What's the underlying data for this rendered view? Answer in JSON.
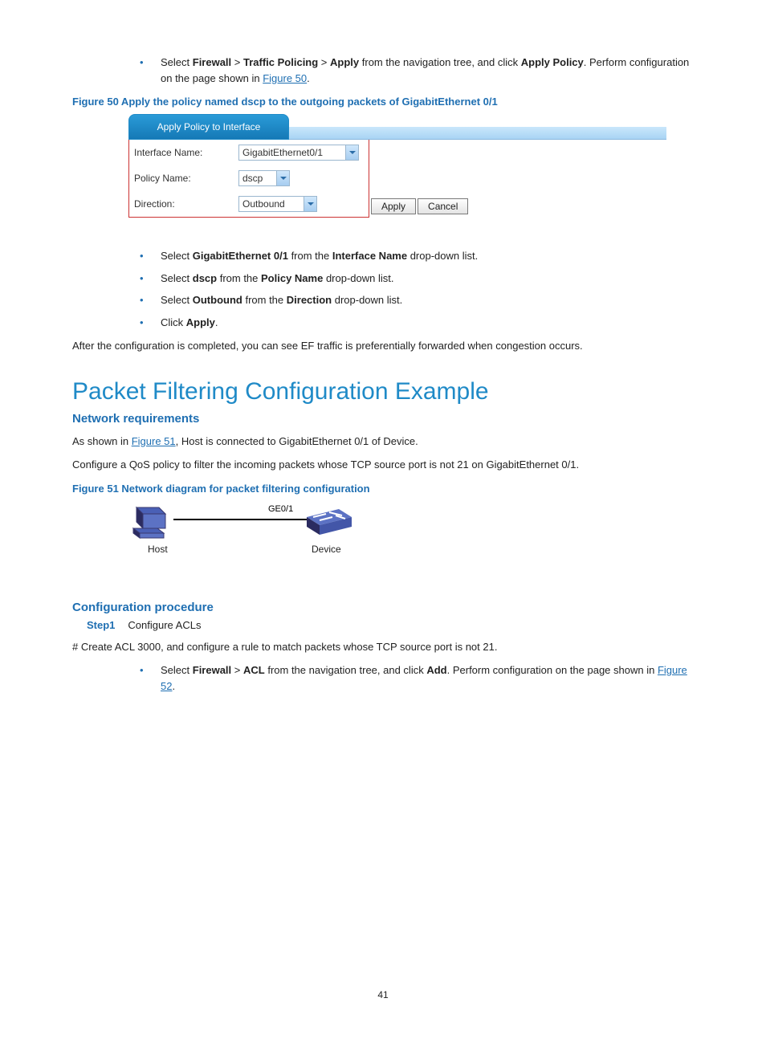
{
  "intro_bullet": {
    "pre1": "Select ",
    "b1": "Firewall",
    "gt1": " > ",
    "b2": "Traffic Policing",
    "gt2": " > ",
    "b3": "Apply",
    "mid": " from the navigation tree, and click ",
    "b4": "Apply Policy",
    "post": ". Perform configuration on the page shown in ",
    "link": "Figure 50",
    "end": "."
  },
  "fig50": {
    "caption_pre": "Figure 50 Apply the policy named ",
    "caption_bold": "dscp",
    "caption_post": " to the outgoing packets of GigabitEthernet 0/1",
    "tab": "Apply Policy to Interface",
    "rows": {
      "r1_label": "Interface Name:",
      "r1_value": "GigabitEthernet0/1",
      "r2_label": "Policy Name:",
      "r2_value": "dscp",
      "r3_label": "Direction:",
      "r3_value": "Outbound"
    },
    "apply": "Apply",
    "cancel": "Cancel"
  },
  "sub_bullets": {
    "l1a": "Select ",
    "l1b": "GigabitEthernet 0/1",
    "l1c": " from the ",
    "l1d": "Interface Name",
    "l1e": " drop-down list.",
    "l2a": "Select ",
    "l2b": "dscp",
    "l2c": " from the ",
    "l2d": "Policy Name",
    "l2e": " drop-down list.",
    "l3a": "Select ",
    "l3b": "Outbound",
    "l3c": " from the ",
    "l3d": "Direction",
    "l3e": " drop-down list.",
    "l4a": "Click ",
    "l4b": "Apply",
    "l4c": "."
  },
  "after_para": "After the configuration is completed, you can see EF traffic is preferentially forwarded when congestion occurs.",
  "h1": "Packet Filtering Configuration Example",
  "h2a": "Network requirements",
  "net_p1a": "As shown in ",
  "net_p1_link": "Figure 51",
  "net_p1b": ", Host is connected to GigabitEthernet 0/1 of Device.",
  "net_p2": "Configure a QoS policy to filter the incoming packets whose TCP source port is not 21 on GigabitEthernet 0/1.",
  "fig51_caption": "Figure 51 Network diagram for packet filtering configuration",
  "diagram": {
    "ge": "GE0/1",
    "host": "Host",
    "device": "Device"
  },
  "h2b": "Configuration procedure",
  "step1_label": "Step1",
  "step1_text": "Configure ACLs",
  "hash_line": "# Create ACL 3000, and configure a rule to match packets whose TCP source port is not 21.",
  "proc_bullet": {
    "a": "Select ",
    "b": "Firewall",
    "c": " > ",
    "d": "ACL",
    "e": " from the navigation tree, and click ",
    "f": "Add",
    "g": ". Perform configuration on the page shown in ",
    "link": "Figure 52",
    "end": "."
  },
  "page_num": "41"
}
